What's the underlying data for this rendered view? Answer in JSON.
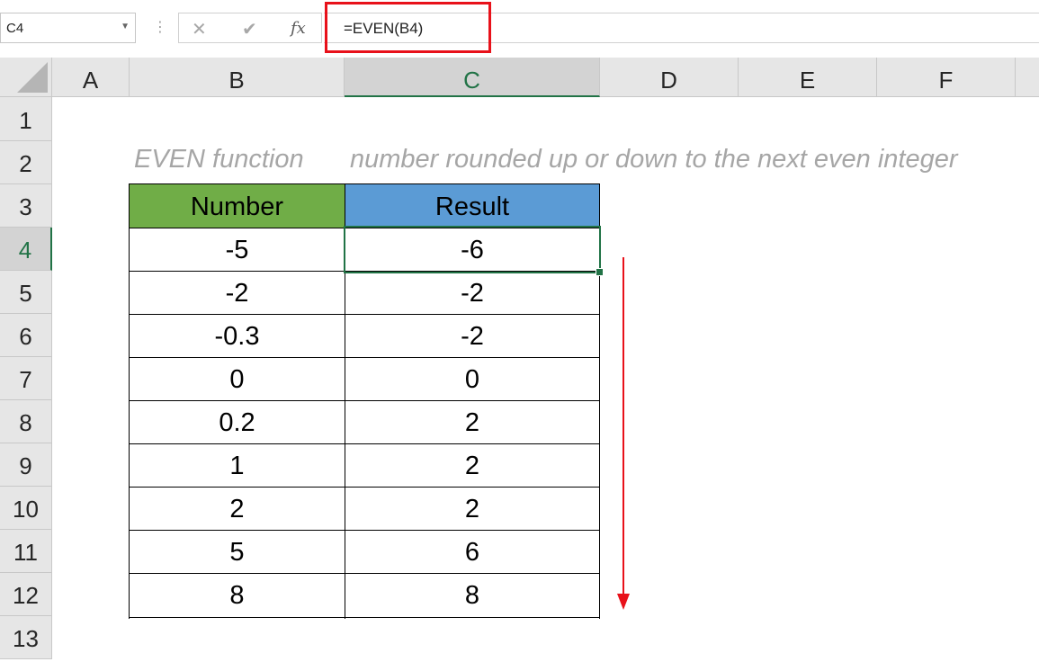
{
  "name_box": {
    "value": "C4"
  },
  "formula_bar": {
    "cancel_icon": "✕",
    "enter_icon": "✔",
    "fx_label": "fx",
    "formula": "=EVEN(B4)"
  },
  "columns": [
    "A",
    "B",
    "C",
    "D",
    "E",
    "F"
  ],
  "rows": [
    "1",
    "2",
    "3",
    "4",
    "5",
    "6",
    "7",
    "8",
    "9",
    "10",
    "11",
    "12",
    "13"
  ],
  "selection": {
    "column": "C",
    "row": "4"
  },
  "subtitles": {
    "b2": "EVEN function",
    "c2": "number rounded up or down to the next even integer"
  },
  "table": {
    "headers": {
      "number": "Number",
      "result": "Result"
    },
    "rows": [
      {
        "number": "-5",
        "result": "-6"
      },
      {
        "number": "-2",
        "result": "-2"
      },
      {
        "number": "-0.3",
        "result": "-2"
      },
      {
        "number": "0",
        "result": "0"
      },
      {
        "number": "0.2",
        "result": "2"
      },
      {
        "number": "1",
        "result": "2"
      },
      {
        "number": "2",
        "result": "2"
      },
      {
        "number": "5",
        "result": "6"
      },
      {
        "number": "8",
        "result": "8"
      }
    ]
  },
  "colors": {
    "number_header": "#70ad47",
    "result_header": "#5b9bd5",
    "selection": "#217346",
    "highlight": "#e8111a",
    "arrow": "#e8111a"
  }
}
